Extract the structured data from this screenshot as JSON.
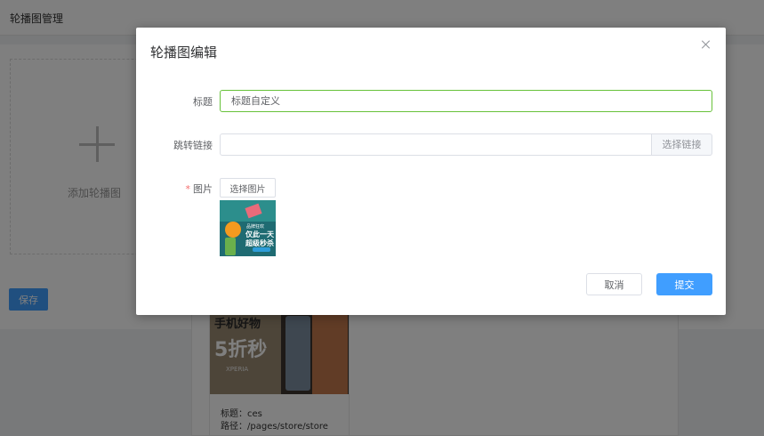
{
  "page": {
    "header_title": "轮播图管理",
    "add_card_label": "添加轮播图",
    "save_label": "保存",
    "banner": {
      "image_text_1": "手机好物",
      "image_text_2": "5折秒",
      "image_text_3": "XPERIA",
      "title_line": "标题：ces",
      "path_line": "路径：/pages/store/store"
    }
  },
  "dialog": {
    "title": "轮播图编辑",
    "fields": {
      "title_label": "标题",
      "title_value": "标题自定义",
      "link_label": "跳转链接",
      "link_value": "",
      "link_button": "选择链接",
      "image_label": "图片",
      "image_required_mark": "*",
      "image_button": "选择图片"
    },
    "thumbnail": {
      "text_small": "品牌狂欢",
      "text_line1": "仅此一天",
      "text_line2": "超级秒杀"
    },
    "cancel_label": "取消",
    "submit_label": "提交"
  },
  "colors": {
    "primary": "#409eff",
    "focus_border": "#67c23a",
    "required": "#f56c6c"
  }
}
